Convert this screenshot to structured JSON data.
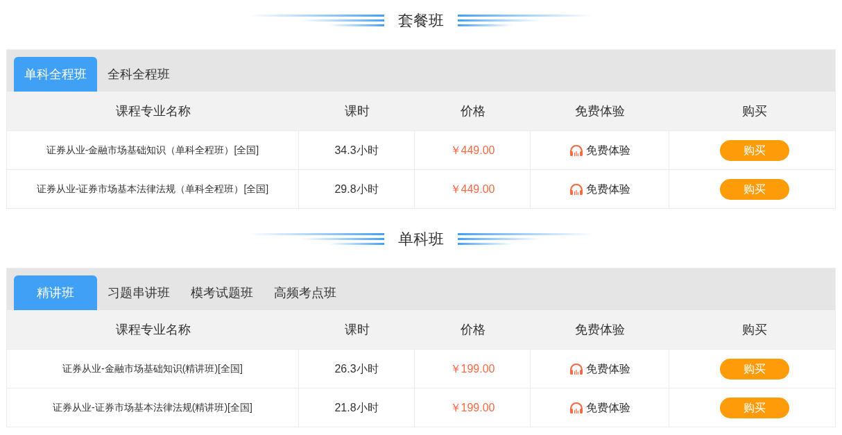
{
  "sections": [
    {
      "title": "套餐班",
      "tabs": [
        {
          "label": "单科全程班",
          "selected": true
        },
        {
          "label": "全科全程班",
          "selected": false
        }
      ],
      "columns": [
        "课程专业名称",
        "课时",
        "价格",
        "免费体验",
        "购买"
      ],
      "rows": [
        {
          "name": "证券从业-金融市场基础知识（单科全程班）[全国]",
          "hours": "34.3小时",
          "price": "￥449.00",
          "trial": "免费体验",
          "buy": "购买"
        },
        {
          "name": "证券从业-证券市场基本法律法规（单科全程班）[全国]",
          "hours": "29.8小时",
          "price": "￥449.00",
          "trial": "免费体验",
          "buy": "购买"
        }
      ]
    },
    {
      "title": "单科班",
      "tabs": [
        {
          "label": "精讲班",
          "selected": true
        },
        {
          "label": "习题串讲班",
          "selected": false
        },
        {
          "label": "模考试题班",
          "selected": false
        },
        {
          "label": "高频考点班",
          "selected": false
        }
      ],
      "columns": [
        "课程专业名称",
        "课时",
        "价格",
        "免费体验",
        "购买"
      ],
      "rows": [
        {
          "name": "证券从业-金融市场基础知识(精讲班)[全国]",
          "hours": "26.3小时",
          "price": "￥199.00",
          "trial": "免费体验",
          "buy": "购买"
        },
        {
          "name": "证券从业-证券市场基本法律法规(精讲班)[全国]",
          "hours": "21.8小时",
          "price": "￥199.00",
          "trial": "免费体验",
          "buy": "购买"
        }
      ]
    }
  ]
}
